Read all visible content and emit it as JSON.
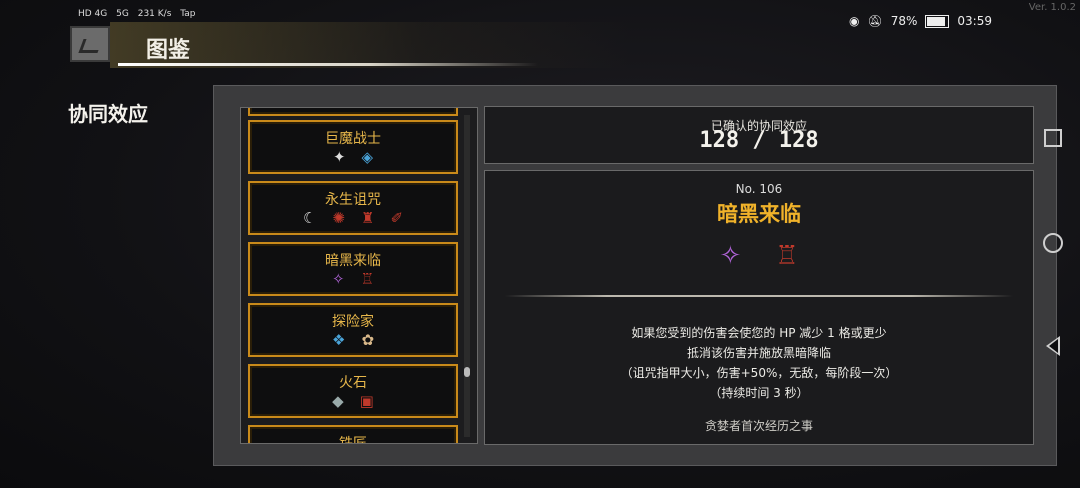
{
  "status_bar": {
    "left": [
      "HD 4G",
      "5G",
      "231 K/s",
      "Tap"
    ],
    "battery": "78%",
    "time": "03:59",
    "version": "Ver. 1.0.2"
  },
  "header": {
    "title": "图鉴",
    "section": "协同效应"
  },
  "list": {
    "items": [
      {
        "label": "巨魔战士",
        "icons": [
          "✦",
          "◈"
        ]
      },
      {
        "label": "永生诅咒",
        "icons": [
          "☾",
          "✺",
          "♜",
          "✐"
        ]
      },
      {
        "label": "暗黑来临",
        "icons": [
          "✧",
          "♖"
        ]
      },
      {
        "label": "探险家",
        "icons": [
          "❖",
          "✿"
        ]
      },
      {
        "label": "火石",
        "icons": [
          "◆",
          "▣"
        ]
      },
      {
        "label": "铁匠",
        "icons": []
      }
    ]
  },
  "counter": {
    "label": "已确认的协同效应",
    "value": "128 / 128"
  },
  "detail": {
    "number": "No. 106",
    "name": "暗黑来临",
    "icons": [
      "✧",
      "♖"
    ],
    "desc": [
      "如果您受到的伤害会使您的 HP 减少 1 格或更少",
      "抵消该伤害并施放黑暗降临",
      "（诅咒指甲大小，伤害+50%，无敌，每阶段一次）",
      "（持续时间 3 秒）"
    ],
    "lore": "贪婪者首次经历之事"
  },
  "colors": {
    "accent_gold": "#c98a1a",
    "title_gold": "#f0b22a"
  }
}
